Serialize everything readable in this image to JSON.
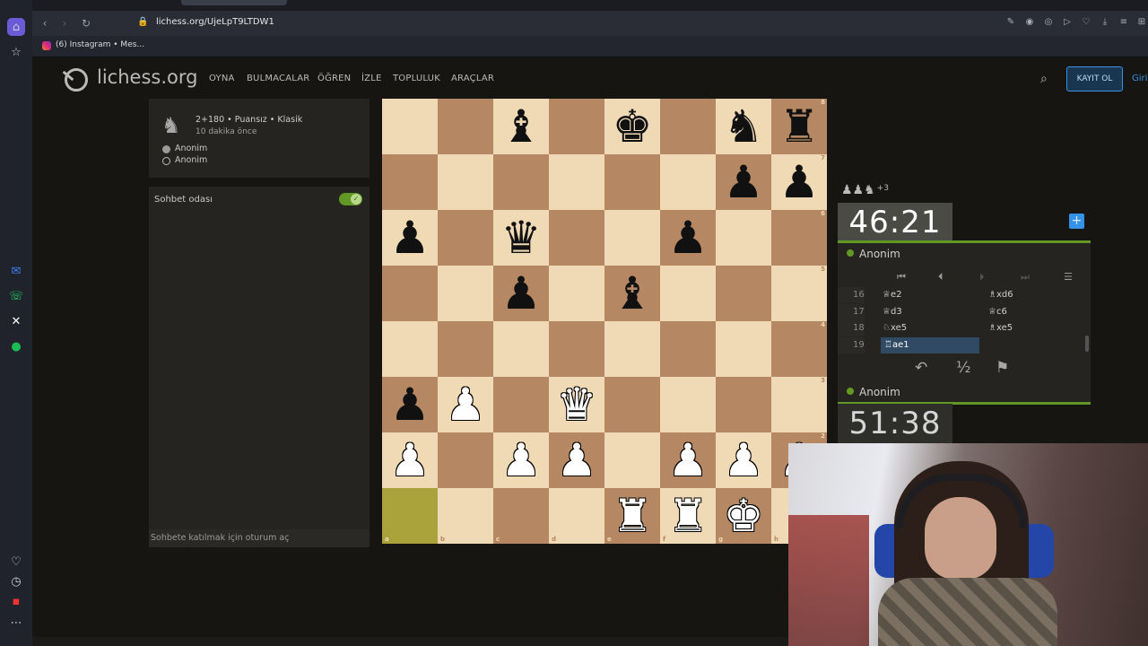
{
  "browser": {
    "url": "lichess.org/UjeLpT9LTDW1",
    "bookmark": "(6) Instagram • Mes..."
  },
  "site": {
    "logo": "lichess.org",
    "nav": [
      "OYNA",
      "BULMACALAR",
      "ÖĞREN",
      "İZLE",
      "TOPLULUK",
      "ARAÇLAR"
    ],
    "signup": "KAYIT OL",
    "signin": "Giriş"
  },
  "game_meta": {
    "line1": "2+180 • Puansız • Klasik",
    "line2": "10 dakika önce",
    "players": [
      "Anonim",
      "Anonim"
    ]
  },
  "chat": {
    "title": "Sohbet odası",
    "toggle_on": true,
    "placeholder": "Sohbete katılmak için oturum aç"
  },
  "board": {
    "orientation": "white",
    "ranks": [
      [
        "",
        "",
        "b-bishop",
        "",
        "b-king",
        "",
        "b-knight",
        "b-rook"
      ],
      [
        "",
        "",
        "",
        "",
        "",
        "",
        "b-pawn",
        "b-pawn"
      ],
      [
        "b-pawn",
        "",
        "b-queen",
        "",
        "",
        "b-pawn",
        "",
        ""
      ],
      [
        "",
        "",
        "b-pawn",
        "",
        "b-bishop",
        "",
        "",
        ""
      ],
      [
        "",
        "",
        "",
        "",
        "",
        "",
        "",
        ""
      ],
      [
        "b-pawn",
        "w-pawn",
        "",
        "w-queen",
        "",
        "",
        "",
        ""
      ],
      [
        "w-pawn",
        "",
        "w-pawn",
        "w-pawn",
        "",
        "w-pawn",
        "w-pawn",
        "w-pawn"
      ],
      [
        "",
        "",
        "",
        "",
        "w-rook",
        "w-rook",
        "w-king",
        ""
      ]
    ],
    "last_move_squares": [
      "a1"
    ],
    "rank_labels": [
      "8",
      "7",
      "6",
      "5",
      "4",
      "3",
      "2",
      "1"
    ],
    "file_labels": [
      "a",
      "b",
      "c",
      "d",
      "e",
      "f",
      "g",
      "h"
    ]
  },
  "right_panel": {
    "material": "♟♟♞",
    "material_diff": "+3",
    "clock_top": "46:21",
    "clock_bottom": "51:38",
    "player_top": "Anonim",
    "player_bottom": "Anonim",
    "moves": [
      {
        "num": "16",
        "white": "♕e2",
        "black": "♗xd6"
      },
      {
        "num": "17",
        "white": "♕d3",
        "black": "♕c6"
      },
      {
        "num": "18",
        "white": "♘xe5",
        "black": "♗xe5"
      },
      {
        "num": "19",
        "white": "♖ae1",
        "black": ""
      }
    ],
    "actions": {
      "takeback": "↶",
      "draw": "½",
      "resign": "⚑"
    }
  }
}
